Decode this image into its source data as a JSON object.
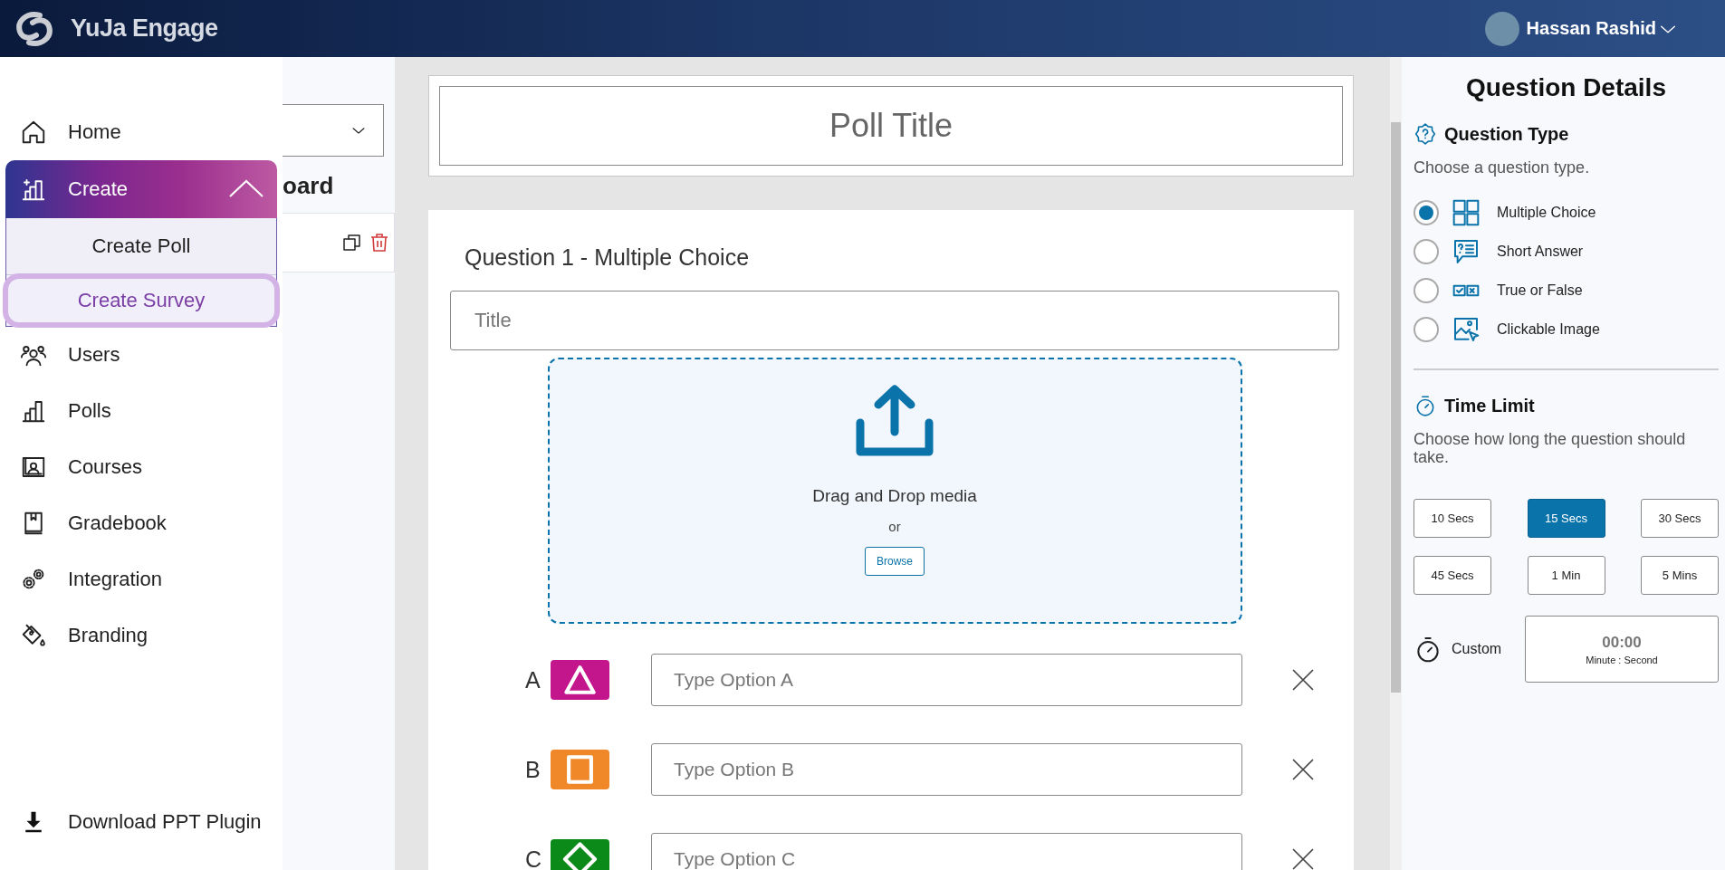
{
  "header": {
    "brand": "YuJa Engage",
    "user_name": "Hassan Rashid"
  },
  "sidebar": {
    "items": [
      {
        "label": "Home",
        "kind": "home",
        "selected": false
      },
      {
        "label": "Create",
        "kind": "create",
        "selected": true,
        "expanded": true,
        "children": [
          {
            "label": "Create Poll",
            "selected": false
          },
          {
            "label": "Create Survey",
            "selected": true
          }
        ]
      },
      {
        "label": "Users",
        "kind": "users",
        "selected": false
      },
      {
        "label": "Polls",
        "kind": "polls",
        "selected": false
      },
      {
        "label": "Courses",
        "kind": "courses",
        "selected": false
      },
      {
        "label": "Gradebook",
        "kind": "gradebook",
        "selected": false
      },
      {
        "label": "Integration",
        "kind": "integration",
        "selected": false
      },
      {
        "label": "Branding",
        "kind": "branding",
        "selected": false
      }
    ],
    "footer_link": "Download PPT Plugin"
  },
  "dashboard": {
    "heading": "oard"
  },
  "poll_title": {
    "placeholder": "Poll Title"
  },
  "question": {
    "heading": "Question 1 - Multiple Choice",
    "title_placeholder": "Title",
    "dropzone": {
      "text": "Drag and Drop media",
      "separator": "or",
      "browse": "Browse"
    },
    "options": [
      {
        "letter": "A",
        "kind": "triangle",
        "color": "#c4168c",
        "placeholder": "Type Option A"
      },
      {
        "letter": "B",
        "kind": "square",
        "color": "#f0882a",
        "placeholder": "Type Option B"
      },
      {
        "letter": "C",
        "kind": "diamond",
        "color": "#0b8a1a",
        "placeholder": "Type Option C"
      }
    ]
  },
  "details": {
    "title": "Question Details",
    "question_type": {
      "heading": "Question Type",
      "description": "Choose a question type.",
      "types": [
        {
          "label": "Multiple Choice",
          "kind": "multiple_choice",
          "selected": true
        },
        {
          "label": "Short Answer",
          "kind": "short_answer",
          "selected": false
        },
        {
          "label": "True or False",
          "kind": "true_false",
          "selected": false
        },
        {
          "label": "Clickable Image",
          "kind": "clickable_image",
          "selected": false
        }
      ]
    },
    "time_limit": {
      "heading": "Time Limit",
      "description": "Choose how long the question should take.",
      "options": [
        {
          "label": "10 Secs",
          "selected": false
        },
        {
          "label": "15 Secs",
          "selected": true
        },
        {
          "label": "30 Secs",
          "selected": false
        },
        {
          "label": "45 Secs",
          "selected": false
        },
        {
          "label": "1 Min",
          "selected": false
        },
        {
          "label": "5 Mins",
          "selected": false
        }
      ],
      "custom": {
        "label": "Custom",
        "value": "00:00",
        "hint": "Minute : Second"
      }
    }
  }
}
